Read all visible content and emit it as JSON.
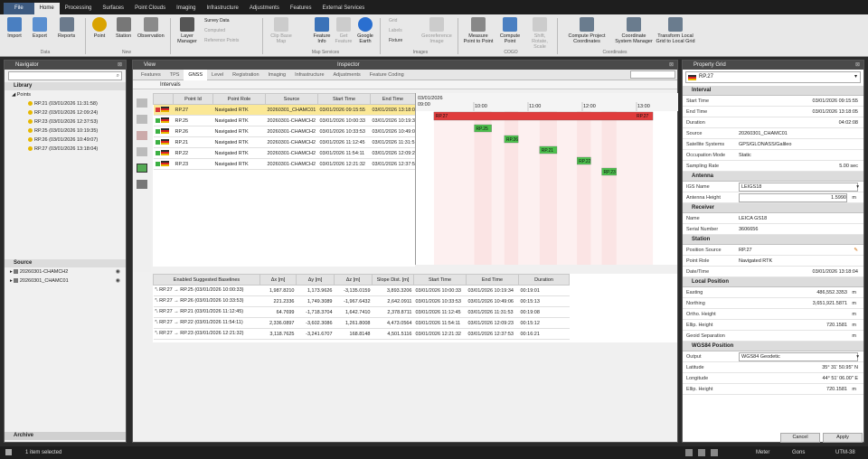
{
  "menu": [
    "File",
    "Home",
    "Processing",
    "Surfaces",
    "Point Clouds",
    "Imaging",
    "Infrastructure",
    "Adjustments",
    "Features",
    "External Services"
  ],
  "ribbon": {
    "import": "Import",
    "export": "Export",
    "reports": "Reports",
    "data_group": "Data",
    "point": "Point",
    "station": "Station",
    "observation": "Observation",
    "new_group": "New",
    "layer_manager": "Layer Manager",
    "survey_data": "Survey Data",
    "computed": "Computed",
    "reference_points": "Reference Points",
    "clip": "Clip Base Map",
    "feature_info": "Feature Info",
    "get_feature": "Get Feature",
    "google_earth": "Google Earth",
    "map_group": "Map Services",
    "grid": "Grid",
    "labels": "Labels",
    "fixture": "Fixture",
    "georef": "Georeference Image",
    "images_group": "Images",
    "measure": "Measure Point to Point",
    "compute_point": "Compute Point",
    "shift": "Shift, Rotate, Scale",
    "cogo_group": "COGO",
    "compute_coords": "Compute Project Coordinates",
    "coord_sys": "Coordinate System Manager",
    "transform": "Transform Local Grid to Local Grid",
    "coordinates_group": "Coordinates"
  },
  "navigator": {
    "title": "Navigator",
    "library": "Library",
    "points_label": "Points",
    "points": [
      "RP.21 (03/01/2026 11:31:58)",
      "RP.22 (03/01/2026 12:09:24)",
      "RP.23 (03/01/2026 12:37:53)",
      "RP.25 (03/01/2026 10:19:35)",
      "RP.26 (03/01/2026 10:49:07)",
      "RP.27 (03/01/2026 13:18:04)"
    ],
    "source": "Source",
    "sources": [
      "20260301-CHAMCH2",
      "20260301_CHAMC01"
    ],
    "archive": "Archive"
  },
  "view": {
    "title": "View",
    "inspector": "Inspector",
    "tabs": [
      "Features",
      "TPS",
      "GNSS",
      "Level",
      "Registration",
      "Imaging",
      "Infrastructure",
      "Adjustments",
      "Feature Coding"
    ],
    "intervals": "Intervals",
    "cols": [
      "Point Id",
      "Point Role",
      "Source",
      "Start Time",
      "End Time"
    ],
    "rows": [
      {
        "c": "#d83838",
        "id": "RP.27",
        "role": "Navigated RTK",
        "src": "20260301_CHAMC01",
        "start": "03/01/2026 09:15:55",
        "end": "03/01/2026 13:18:0"
      },
      {
        "c": "#3cb043",
        "id": "RP.25",
        "role": "Navigated RTK",
        "src": "20260301-CHAMCH2",
        "start": "03/01/2026 10:00:33",
        "end": "03/01/2026 10:19:3"
      },
      {
        "c": "#3cb043",
        "id": "RP.26",
        "role": "Navigated RTK",
        "src": "20260301-CHAMCH2",
        "start": "03/01/2026 10:33:53",
        "end": "03/01/2026 10:49:0"
      },
      {
        "c": "#3cb043",
        "id": "RP.21",
        "role": "Navigated RTK",
        "src": "20260301-CHAMCH2",
        "start": "03/01/2026 11:12:45",
        "end": "03/01/2026 11:31:5"
      },
      {
        "c": "#3cb043",
        "id": "RP.22",
        "role": "Navigated RTK",
        "src": "20260301-CHAMCH2",
        "start": "03/01/2026 11:54:11",
        "end": "03/01/2026 12:09:2"
      },
      {
        "c": "#3cb043",
        "id": "RP.23",
        "role": "Navigated RTK",
        "src": "20260301-CHAMCH2",
        "start": "03/01/2026 12:21:32",
        "end": "03/01/2026 12:37:5"
      }
    ],
    "timeline": {
      "date": "03/01/2026",
      "t0": "09:00",
      "ticks": [
        "10:00",
        "11:00",
        "12:00",
        "13:00"
      ],
      "bars": [
        {
          "label": "RP.27",
          "label2": "RP.27",
          "start": 9.265,
          "end": 13.301,
          "color": "#e03c3c"
        },
        {
          "label": "RP.25",
          "start": 10.009,
          "end": 10.327,
          "color": "#4cc04c"
        },
        {
          "label": "RP.26",
          "start": 10.564,
          "end": 10.819,
          "color": "#4cc04c"
        },
        {
          "label": "RP.21",
          "start": 11.213,
          "end": 11.533,
          "color": "#4cc04c"
        },
        {
          "label": "RP.22",
          "start": 11.903,
          "end": 12.157,
          "color": "#4cc04c"
        },
        {
          "label": "RP.23",
          "start": 12.359,
          "end": 12.631,
          "color": "#4cc04c"
        }
      ]
    },
    "bcols": [
      "Enabled Suggested Baselines",
      "Δx [m]",
      "Δy [m]",
      "Δz [m]",
      "Slope Dist. [m]",
      "Start Time",
      "End Time",
      "Duration"
    ],
    "brows": [
      [
        "RP.27 → RP.25 (03/01/2026 10:00:33)",
        "1,987.8210",
        "1,173.9626",
        "-3,135.0159",
        "3,893.3206",
        "03/01/2026 10:00:33",
        "03/01/2026 10:19:34",
        "00:19:01"
      ],
      [
        "RP.27 → RP.26 (03/01/2026 10:33:53)",
        "221.2336",
        "1,749.3089",
        "-1,967.6432",
        "2,642.0911",
        "03/01/2026 10:33:53",
        "03/01/2026 10:49:06",
        "00:15:13"
      ],
      [
        "RP.27 → RP.21 (03/01/2026 11:12:45)",
        "64.7699",
        "-1,718.3704",
        "1,642.7410",
        "2,378.8711",
        "03/01/2026 11:12:45",
        "03/01/2026 11:31:53",
        "00:19:08"
      ],
      [
        "RP.27 → RP.22 (03/01/2026 11:54:11)",
        "2,336.0897",
        "-3,602.3086",
        "1,261.8008",
        "4,473.0564",
        "03/01/2026 11:54:11",
        "03/01/2026 12:09:23",
        "00:15:12"
      ],
      [
        "RP.27 → RP.23 (03/01/2026 12:21:32)",
        "3,118.7625",
        "-3,241.6707",
        "168.8148",
        "4,501.5116",
        "03/01/2026 12:21:32",
        "03/01/2026 12:37:53",
        "00:16:21"
      ]
    ]
  },
  "props": {
    "title": "Property Grid",
    "selected": "RP.27",
    "interval": "Interval",
    "start_time": [
      "Start Time",
      "03/01/2026 09:15:55"
    ],
    "end_time": [
      "End Time",
      "03/01/2026 13:18:05"
    ],
    "duration": [
      "Duration",
      "04:02:08"
    ],
    "source": [
      "Source",
      "20260301_CHAMC01"
    ],
    "satellite": [
      "Satellite Systems",
      "GPS/GLONASS/Galileo"
    ],
    "occupation": [
      "Occupation Mode",
      "Static"
    ],
    "sampling": [
      "Sampling Rate",
      "5.00 sec"
    ],
    "antenna": "Antenna",
    "igs": [
      "IGS Name",
      "LEIGS18"
    ],
    "ant_height": [
      "Antenna Height",
      "1.5990",
      "m"
    ],
    "receiver": "Receiver",
    "rname": [
      "Name",
      "LEICA GS18"
    ],
    "serial": [
      "Serial Number",
      "3606656"
    ],
    "station": "Station",
    "pos_source": [
      "Position Source",
      "RP.27"
    ],
    "point_role": [
      "Point Role",
      "Navigated RTK"
    ],
    "datetime": [
      "Date/Time",
      "03/01/2026 13:18:04"
    ],
    "local": "Local Position",
    "easting": [
      "Easting",
      "486,552.3353",
      "m"
    ],
    "northing": [
      "Northing",
      "3,651,921.5871",
      "m"
    ],
    "ortho": [
      "Ortho. Height",
      "",
      "m"
    ],
    "ellip": [
      "Ellip. Height",
      "720.1581",
      "m"
    ],
    "geoid": [
      "Geoid Separation",
      "",
      "m"
    ],
    "wgs": "WGS84 Position",
    "output": [
      "Output",
      "WGS84 Geodetic"
    ],
    "lat": [
      "Latitude",
      "35° 31' 50.95\" N"
    ],
    "lon": [
      "Longitude",
      "44° 51' 06.00\" E"
    ],
    "wellip": [
      "Ellip. Height",
      "720.1581",
      "m"
    ],
    "cancel": "Cancel",
    "apply": "Apply"
  },
  "status": {
    "selected": "1 item selected",
    "units": "Meter",
    "angle": "Gons",
    "crs": "UTM-38"
  }
}
